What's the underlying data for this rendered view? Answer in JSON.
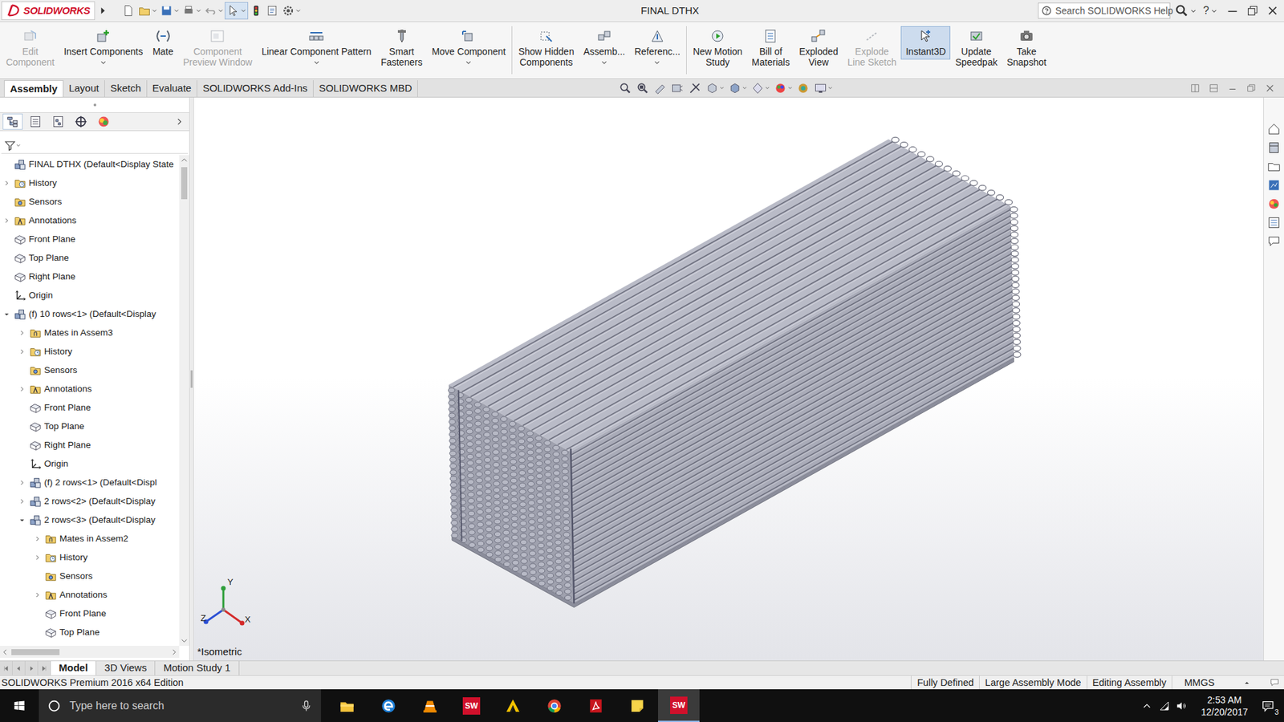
{
  "app": {
    "name": "SOLIDWORKS",
    "help": "?"
  },
  "window": {
    "title": "FINAL DTHX"
  },
  "help_search": {
    "placeholder": "Search SOLIDWORKS Help"
  },
  "ribbon": {
    "groups": [
      [
        {
          "label": "Edit\nComponent",
          "disabled": true,
          "selected": false,
          "dropdown": false
        },
        {
          "label": "Insert Components",
          "disabled": false,
          "selected": false,
          "dropdown": true
        },
        {
          "label": "Mate",
          "disabled": false,
          "selected": false,
          "dropdown": false
        },
        {
          "label": "Component\nPreview Window",
          "disabled": true,
          "selected": false,
          "dropdown": false
        },
        {
          "label": "Linear Component Pattern",
          "disabled": false,
          "selected": false,
          "dropdown": true
        },
        {
          "label": "Smart\nFasteners",
          "disabled": false,
          "selected": false,
          "dropdown": false
        },
        {
          "label": "Move Component",
          "disabled": false,
          "selected": false,
          "dropdown": true
        }
      ],
      [
        {
          "label": "Show Hidden\nComponents",
          "disabled": false,
          "selected": false,
          "dropdown": false
        },
        {
          "label": "Assemb...",
          "disabled": false,
          "selected": false,
          "dropdown": true
        },
        {
          "label": "Referenc...",
          "disabled": false,
          "selected": false,
          "dropdown": true
        }
      ],
      [
        {
          "label": "New Motion\nStudy",
          "disabled": false,
          "selected": false,
          "dropdown": false
        },
        {
          "label": "Bill of\nMaterials",
          "disabled": false,
          "selected": false,
          "dropdown": false
        },
        {
          "label": "Exploded\nView",
          "disabled": false,
          "selected": false,
          "dropdown": false
        },
        {
          "label": "Explode\nLine Sketch",
          "disabled": true,
          "selected": false,
          "dropdown": false
        },
        {
          "label": "Instant3D",
          "disabled": false,
          "selected": true,
          "dropdown": false
        },
        {
          "label": "Update\nSpeedpak",
          "disabled": false,
          "selected": false,
          "dropdown": false
        },
        {
          "label": "Take\nSnapshot",
          "disabled": false,
          "selected": false,
          "dropdown": false
        }
      ]
    ]
  },
  "command_tabs": [
    {
      "label": "Assembly",
      "selected": true
    },
    {
      "label": "Layout",
      "selected": false
    },
    {
      "label": "Sketch",
      "selected": false
    },
    {
      "label": "Evaluate",
      "selected": false
    },
    {
      "label": "SOLIDWORKS Add-Ins",
      "selected": false
    },
    {
      "label": "SOLIDWORKS MBD",
      "selected": false
    }
  ],
  "panel_tabs": [
    {
      "kind": "featuremanager",
      "selected": true
    },
    {
      "kind": "propertymanager",
      "selected": false
    },
    {
      "kind": "configurationmanager",
      "selected": false
    },
    {
      "kind": "dimxpertmanager",
      "selected": false
    },
    {
      "kind": "displaymanager",
      "selected": false
    }
  ],
  "tree": {
    "items": [
      {
        "label": "FINAL DTHX  (Default<Display State",
        "depth": 0,
        "kind": "assembly",
        "expandable": false,
        "expanded": false
      },
      {
        "label": "History",
        "depth": 0,
        "kind": "history",
        "expandable": true,
        "expanded": false
      },
      {
        "label": "Sensors",
        "depth": 0,
        "kind": "sensor",
        "expandable": false,
        "expanded": false
      },
      {
        "label": "Annotations",
        "depth": 0,
        "kind": "annotation",
        "expandable": true,
        "expanded": false
      },
      {
        "label": "Front Plane",
        "depth": 0,
        "kind": "plane",
        "expandable": false,
        "expanded": false
      },
      {
        "label": "Top Plane",
        "depth": 0,
        "kind": "plane",
        "expandable": false,
        "expanded": false
      },
      {
        "label": "Right Plane",
        "depth": 0,
        "kind": "plane",
        "expandable": false,
        "expanded": false
      },
      {
        "label": "Origin",
        "depth": 0,
        "kind": "origin",
        "expandable": false,
        "expanded": false
      },
      {
        "label": "(f) 10 rows<1> (Default<Display",
        "depth": 0,
        "kind": "assembly",
        "expandable": true,
        "expanded": true
      },
      {
        "label": "Mates in Assem3",
        "depth": 1,
        "kind": "mates",
        "expandable": true,
        "expanded": false
      },
      {
        "label": "History",
        "depth": 1,
        "kind": "history",
        "expandable": true,
        "expanded": false
      },
      {
        "label": "Sensors",
        "depth": 1,
        "kind": "sensor",
        "expandable": false,
        "expanded": false
      },
      {
        "label": "Annotations",
        "depth": 1,
        "kind": "annotation",
        "expandable": true,
        "expanded": false
      },
      {
        "label": "Front Plane",
        "depth": 1,
        "kind": "plane",
        "expandable": false,
        "expanded": false
      },
      {
        "label": "Top Plane",
        "depth": 1,
        "kind": "plane",
        "expandable": false,
        "expanded": false
      },
      {
        "label": "Right Plane",
        "depth": 1,
        "kind": "plane",
        "expandable": false,
        "expanded": false
      },
      {
        "label": "Origin",
        "depth": 1,
        "kind": "origin",
        "expandable": false,
        "expanded": false
      },
      {
        "label": "(f) 2 rows<1> (Default<Displ",
        "depth": 1,
        "kind": "assembly",
        "expandable": true,
        "expanded": false
      },
      {
        "label": "2 rows<2> (Default<Display",
        "depth": 1,
        "kind": "assembly",
        "expandable": true,
        "expanded": false
      },
      {
        "label": "2 rows<3> (Default<Display",
        "depth": 1,
        "kind": "assembly",
        "expandable": true,
        "expanded": true
      },
      {
        "label": "Mates in Assem2",
        "depth": 2,
        "kind": "mates",
        "expandable": true,
        "expanded": false
      },
      {
        "label": "History",
        "depth": 2,
        "kind": "history",
        "expandable": true,
        "expanded": false
      },
      {
        "label": "Sensors",
        "depth": 2,
        "kind": "sensor",
        "expandable": false,
        "expanded": false
      },
      {
        "label": "Annotations",
        "depth": 2,
        "kind": "annotation",
        "expandable": true,
        "expanded": false
      },
      {
        "label": "Front Plane",
        "depth": 2,
        "kind": "plane",
        "expandable": false,
        "expanded": false
      },
      {
        "label": "Top Plane",
        "depth": 2,
        "kind": "plane",
        "expandable": false,
        "expanded": false
      }
    ]
  },
  "view": {
    "label": "*Isometric",
    "triad": [
      {
        "label": "Y",
        "color": "#2e9e3a"
      },
      {
        "label": "Z",
        "color": "#2b4fd4"
      },
      {
        "label": "X",
        "color": "#d42b2b"
      }
    ]
  },
  "bottom_tabs": [
    {
      "label": "Model",
      "selected": true
    },
    {
      "label": "3D Views",
      "selected": false
    },
    {
      "label": "Motion Study 1",
      "selected": false
    }
  ],
  "status_bar": {
    "edition": "SOLIDWORKS Premium 2016 x64 Edition",
    "items": [
      "Fully Defined",
      "Large Assembly Mode",
      "Editing Assembly"
    ],
    "units": "MMGS"
  },
  "taskbar": {
    "search_placeholder": "Type here to search",
    "apps": [
      {
        "kind": "explorer",
        "label": "",
        "active": false
      },
      {
        "kind": "edge",
        "label": "",
        "active": false
      },
      {
        "kind": "vlc",
        "label": "",
        "active": false
      },
      {
        "kind": "solidworks",
        "label": "SW",
        "active": false
      },
      {
        "kind": "autodesk",
        "label": "",
        "active": false
      },
      {
        "kind": "chrome",
        "label": "",
        "active": false
      },
      {
        "kind": "acrobat",
        "label": "",
        "active": false
      },
      {
        "kind": "sticky",
        "label": "",
        "active": false
      },
      {
        "kind": "solidworks",
        "label": "SW",
        "active": true
      }
    ],
    "time": "2:53 AM",
    "date": "12/20/2017",
    "notifications": "3"
  }
}
